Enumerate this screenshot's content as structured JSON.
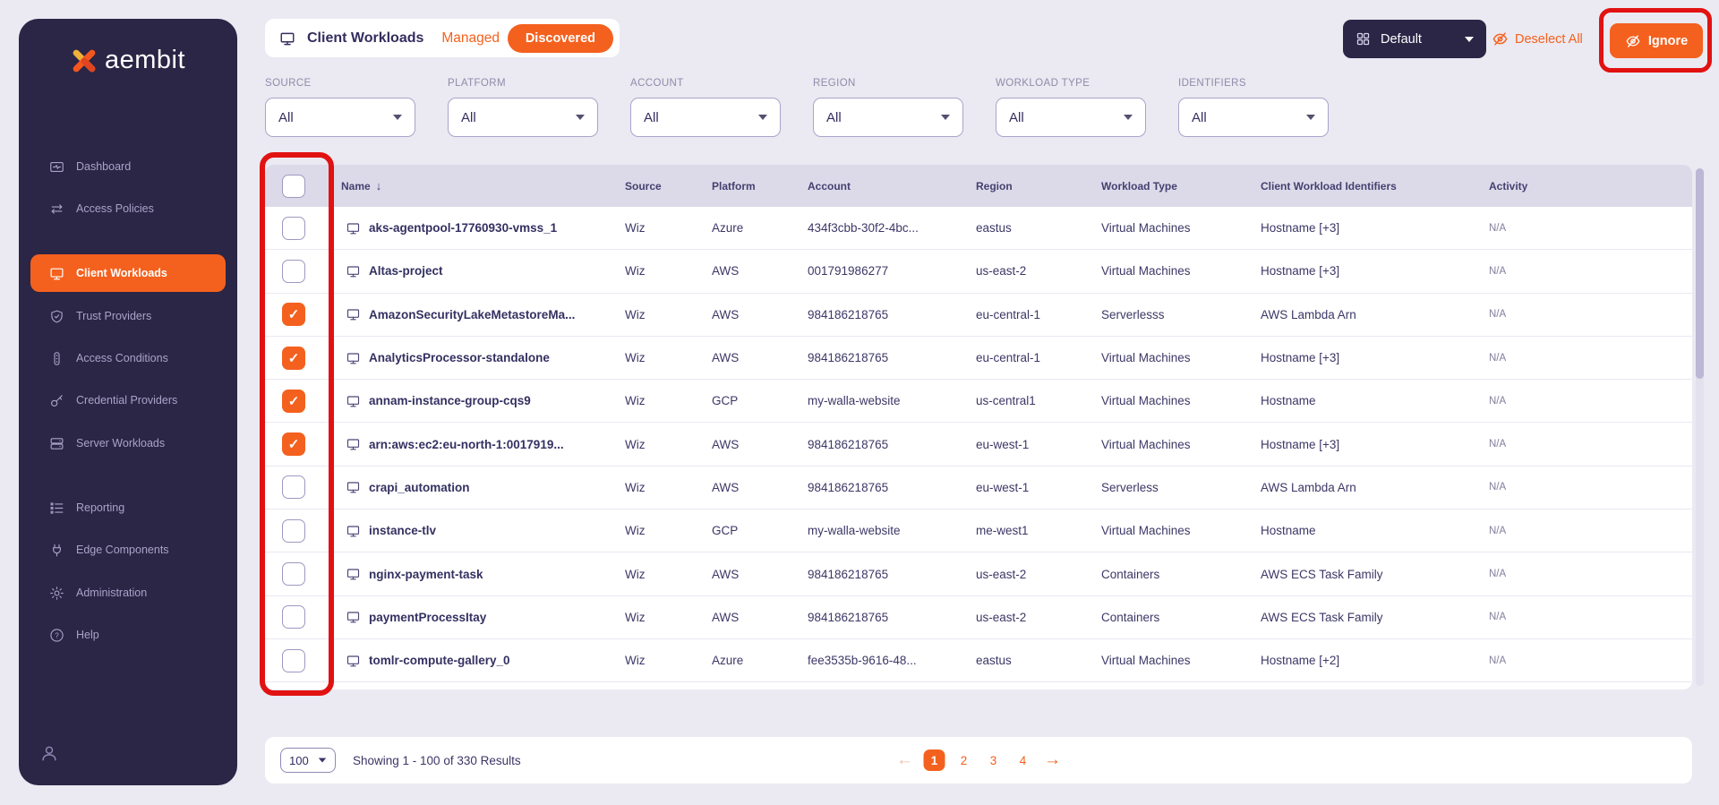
{
  "brand": {
    "logo_text": "aembit"
  },
  "sidebar": {
    "nav": [
      {
        "label": "Dashboard",
        "active": false
      },
      {
        "label": "Access Policies",
        "active": false
      },
      {
        "label": "Client Workloads",
        "active": true
      },
      {
        "label": "Trust Providers",
        "active": false
      },
      {
        "label": "Access Conditions",
        "active": false
      },
      {
        "label": "Credential Providers",
        "active": false
      },
      {
        "label": "Server Workloads",
        "active": false
      }
    ],
    "nav_secondary": [
      {
        "label": "Reporting"
      },
      {
        "label": "Edge Components"
      },
      {
        "label": "Administration"
      },
      {
        "label": "Help"
      }
    ]
  },
  "header": {
    "title": "Client Workloads",
    "tab_managed": "Managed",
    "tab_discovered": "Discovered",
    "view_selector": "Default",
    "deselect_all": "Deselect All",
    "ignore": "Ignore"
  },
  "filters": [
    {
      "label": "SOURCE",
      "value": "All"
    },
    {
      "label": "PLATFORM",
      "value": "All"
    },
    {
      "label": "ACCOUNT",
      "value": "All"
    },
    {
      "label": "REGION",
      "value": "All"
    },
    {
      "label": "WORKLOAD TYPE",
      "value": "All"
    },
    {
      "label": "IDENTIFIERS",
      "value": "All"
    }
  ],
  "table": {
    "columns": [
      "Name",
      "Source",
      "Platform",
      "Account",
      "Region",
      "Workload Type",
      "Client Workload Identifiers",
      "Activity"
    ],
    "sort_column": "Name",
    "select_all_checked": false,
    "rows": [
      {
        "checked": false,
        "name": "aks-agentpool-17760930-vmss_1",
        "source": "Wiz",
        "platform": "Azure",
        "account": "434f3cbb-30f2-4bc...",
        "region": "eastus",
        "workload_type": "Virtual Machines",
        "identifiers": "Hostname [+3]",
        "activity": "N/A"
      },
      {
        "checked": false,
        "name": "Altas-project",
        "source": "Wiz",
        "platform": "AWS",
        "account": "001791986277",
        "region": "us-east-2",
        "workload_type": "Virtual Machines",
        "identifiers": "Hostname [+3]",
        "activity": "N/A"
      },
      {
        "checked": true,
        "name": "AmazonSecurityLakeMetastoreMa...",
        "source": "Wiz",
        "platform": "AWS",
        "account": "984186218765",
        "region": "eu-central-1",
        "workload_type": "Serverlesss",
        "identifiers": "AWS Lambda Arn",
        "activity": "N/A"
      },
      {
        "checked": true,
        "name": "AnalyticsProcessor-standalone",
        "source": "Wiz",
        "platform": "AWS",
        "account": "984186218765",
        "region": "eu-central-1",
        "workload_type": "Virtual Machines",
        "identifiers": "Hostname [+3]",
        "activity": "N/A"
      },
      {
        "checked": true,
        "name": "annam-instance-group-cqs9",
        "source": "Wiz",
        "platform": "GCP",
        "account": "my-walla-website",
        "region": "us-central1",
        "workload_type": "Virtual Machines",
        "identifiers": "Hostname",
        "activity": "N/A"
      },
      {
        "checked": true,
        "name": "arn:aws:ec2:eu-north-1:0017919...",
        "source": "Wiz",
        "platform": "AWS",
        "account": "984186218765",
        "region": "eu-west-1",
        "workload_type": "Virtual Machines",
        "identifiers": "Hostname [+3]",
        "activity": "N/A"
      },
      {
        "checked": false,
        "name": "crapi_automation",
        "source": "Wiz",
        "platform": "AWS",
        "account": "984186218765",
        "region": "eu-west-1",
        "workload_type": "Serverless",
        "identifiers": "AWS Lambda Arn",
        "activity": "N/A"
      },
      {
        "checked": false,
        "name": "instance-tlv",
        "source": "Wiz",
        "platform": "GCP",
        "account": "my-walla-website",
        "region": "me-west1",
        "workload_type": "Virtual Machines",
        "identifiers": "Hostname",
        "activity": "N/A"
      },
      {
        "checked": false,
        "name": "nginx-payment-task",
        "source": "Wiz",
        "platform": "AWS",
        "account": "984186218765",
        "region": "us-east-2",
        "workload_type": "Containers",
        "identifiers": "AWS ECS Task Family",
        "activity": "N/A"
      },
      {
        "checked": false,
        "name": "paymentProcessItay",
        "source": "Wiz",
        "platform": "AWS",
        "account": "984186218765",
        "region": "us-east-2",
        "workload_type": "Containers",
        "identifiers": "AWS ECS Task Family",
        "activity": "N/A"
      },
      {
        "checked": false,
        "name": "tomlr-compute-gallery_0",
        "source": "Wiz",
        "platform": "Azure",
        "account": "fee3535b-9616-48...",
        "region": "eastus",
        "workload_type": "Virtual Machines",
        "identifiers": "Hostname [+2]",
        "activity": "N/A"
      }
    ]
  },
  "pagination": {
    "page_size": "100",
    "summary": "Showing 1 - 100 of 330 Results",
    "pages": [
      "1",
      "2",
      "3",
      "4"
    ],
    "active_page": "1"
  },
  "icons": {
    "check": "✓",
    "sort_desc": "↓",
    "prev_arrow": "←",
    "next_arrow": "→"
  },
  "colors": {
    "accent_orange": "#f4611e",
    "sidebar_purple": "#2b2546",
    "annotation_red": "#e11212",
    "table_header_bg": "#dcdae9",
    "background": "#ebe9f1"
  }
}
